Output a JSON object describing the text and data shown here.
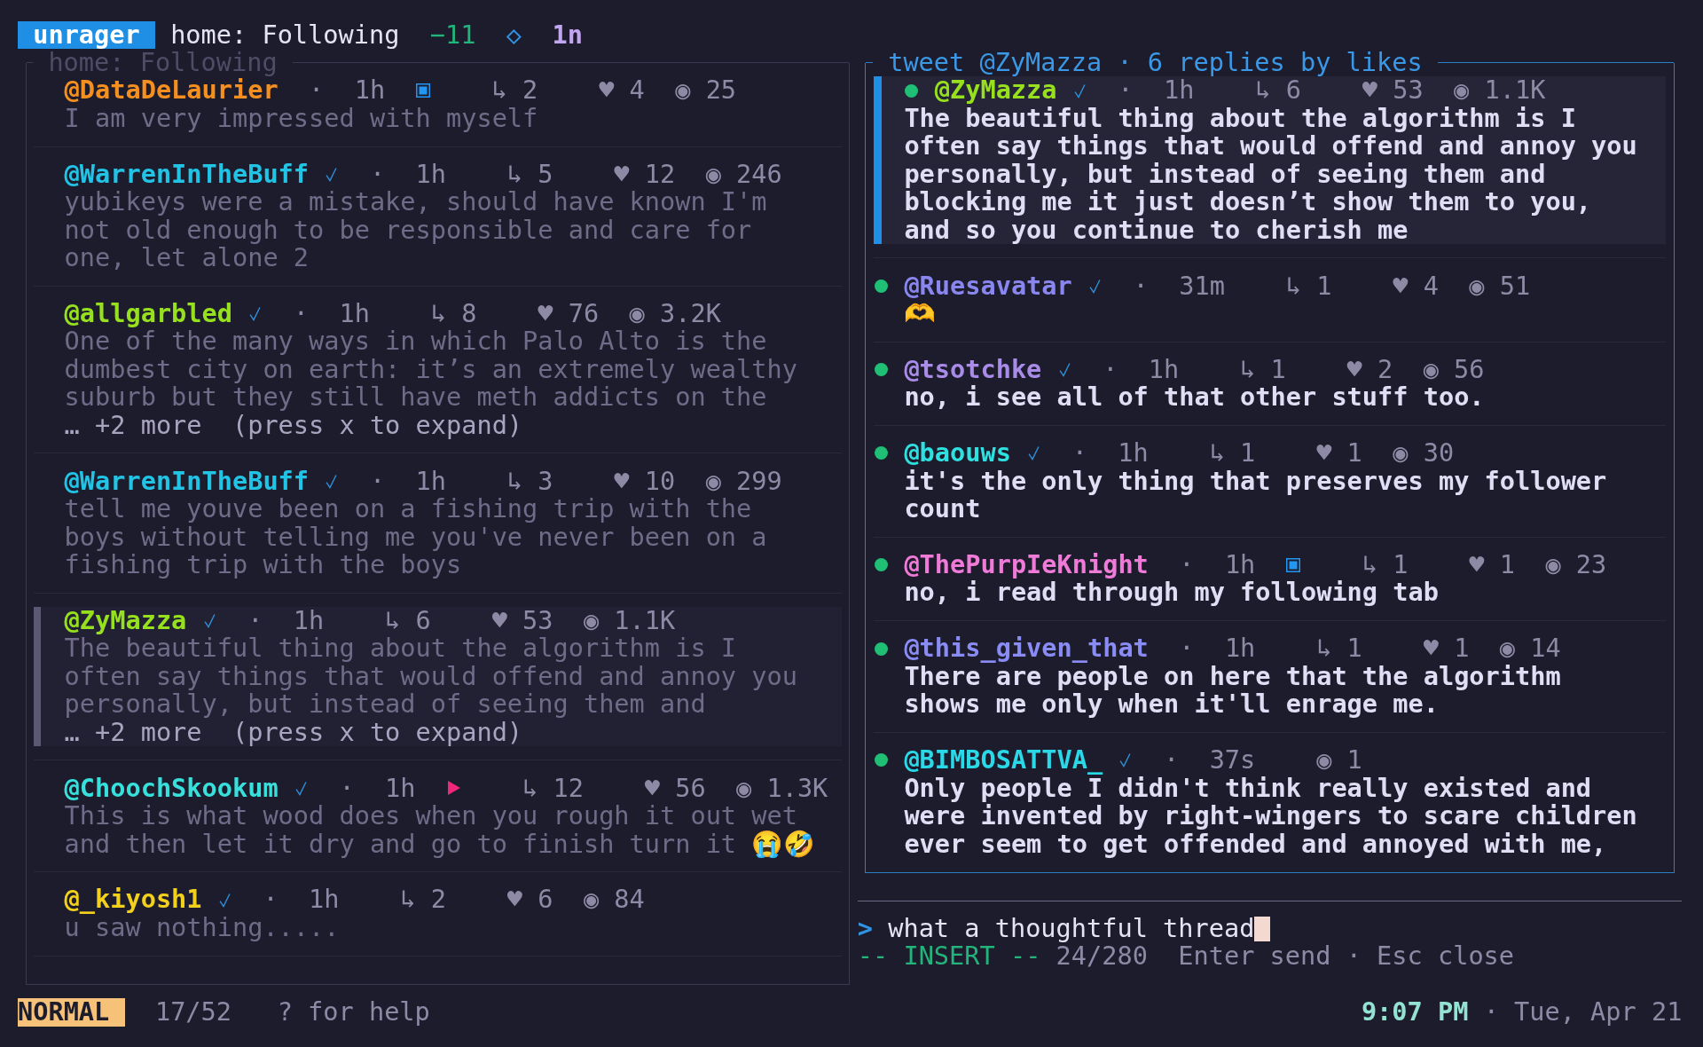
{
  "top_bar": {
    "badge": "unrager",
    "feed": "home: Following",
    "delta": "−11",
    "symbol": "◇",
    "counter": "1n"
  },
  "timeline": {
    "title": "home: Following",
    "tweets": [
      {
        "handle": "@DataDeLaurier",
        "color": "#f59020",
        "verified": false,
        "separator": "·",
        "time": "1h",
        "media": {
          "kind": "image"
        },
        "replies": "↳ 2",
        "likes": "♥ 4",
        "views": "◉ 25",
        "body": "I am very impressed with myself",
        "selected": false
      },
      {
        "handle": "@WarrenInTheBuff",
        "color": "#22c4e6",
        "verified": true,
        "separator": "·",
        "time": "1h",
        "replies": "↳ 5",
        "likes": "♥ 12",
        "views": "◉ 246",
        "body": "yubikeys were a mistake, should have known I'm\nnot old enough to be responsible and care for\none, let alone 2",
        "selected": false
      },
      {
        "handle": "@allgarbled",
        "color": "#96e01e",
        "verified": true,
        "separator": "·",
        "time": "1h",
        "replies": "↳ 8",
        "likes": "♥ 76",
        "views": "◉ 3.2K",
        "body": "One of the many ways in which Palo Alto is the\ndumbest city on earth: it’s an extremely wealthy\nsuburb but they still have meth addicts on the",
        "more": "… +2 more  (press x to expand)",
        "selected": false
      },
      {
        "handle": "@WarrenInTheBuff",
        "color": "#22c4e6",
        "verified": true,
        "separator": "·",
        "time": "1h",
        "replies": "↳ 3",
        "likes": "♥ 10",
        "views": "◉ 299",
        "body": "tell me youve been on a fishing trip with the\nboys without telling me you've never been on a\nfishing trip with the boys",
        "selected": false
      },
      {
        "handle": "@ZyMazza",
        "color": "#96e01e",
        "verified": true,
        "separator": "·",
        "time": "1h",
        "replies": "↳ 6",
        "likes": "♥ 53",
        "views": "◉ 1.1K",
        "body": "The beautiful thing about the algorithm is I\noften say things that would offend and annoy you\npersonally, but instead of seeing them and",
        "more": "… +2 more  (press x to expand)",
        "selected": true
      },
      {
        "handle": "@ChoochSkookum",
        "color": "#38e0dc",
        "verified": true,
        "separator": "·",
        "time": "1h",
        "media": {
          "kind": "video"
        },
        "replies": "↳ 12",
        "likes": "♥ 56",
        "views": "◉ 1.3K",
        "body": "This is what wood does when you rough it out wet\nand then let it dry and go to finish turn it 😭🤣",
        "selected": false
      },
      {
        "handle": "@_kiyosh1",
        "color": "#f2d01c",
        "verified": true,
        "separator": "·",
        "time": "1h",
        "replies": "↳ 2",
        "likes": "♥ 6",
        "views": "◉ 84",
        "body": "u saw nothing.....",
        "selected": false
      }
    ]
  },
  "thread": {
    "title": "tweet @ZyMazza · 6 replies by likes",
    "replies": [
      {
        "handle": "@ZyMazza",
        "color": "#96e01e",
        "verified": true,
        "dot": true,
        "separator": "·",
        "time": "1h",
        "replies": "↳ 6",
        "likes": "♥ 53",
        "views": "◉ 1.1K",
        "body": "The beautiful thing about the algorithm is I\noften say things that would offend and annoy you\npersonally, but instead of seeing them and\nblocking me it just doesn’t show them to you,\nand so you continue to cherish me",
        "selected": true
      },
      {
        "handle": "@Ruesavatar",
        "color": "#8a86f0",
        "verified": true,
        "dot": true,
        "separator": "·",
        "time": "31m",
        "replies": "↳ 1",
        "likes": "♥ 4",
        "views": "◉ 51",
        "body": "🫶",
        "selected": false
      },
      {
        "handle": "@tsotchke",
        "color": "#a98be8",
        "verified": true,
        "dot": true,
        "separator": "·",
        "time": "1h",
        "replies": "↳ 1",
        "likes": "♥ 2",
        "views": "◉ 56",
        "body": "no, i see all of that other stuff too.",
        "selected": false
      },
      {
        "handle": "@baouws",
        "color": "#2ee0e0",
        "verified": true,
        "dot": true,
        "separator": "·",
        "time": "1h",
        "replies": "↳ 1",
        "likes": "♥ 1",
        "views": "◉ 30",
        "body": "it's the only thing that preserves my follower\ncount",
        "selected": false
      },
      {
        "handle": "@ThePurpIeKnight",
        "color": "#f07ad8",
        "verified": false,
        "dot": true,
        "separator": "·",
        "time": "1h",
        "media": {
          "kind": "image"
        },
        "replies": "↳ 1",
        "likes": "♥ 1",
        "views": "◉ 23",
        "body": "no, i read through my following tab",
        "selected": false
      },
      {
        "handle": "@this_given_that",
        "color": "#8a8cf5",
        "verified": false,
        "dot": true,
        "separator": "·",
        "time": "1h",
        "replies": "↳ 1",
        "likes": "♥ 1",
        "views": "◉ 14",
        "body": "There are people on here that the algorithm\nshows me only when it'll enrage me.",
        "selected": false
      },
      {
        "handle": "@BIMBOSATTVA_",
        "color": "#2ad8e8",
        "verified": true,
        "dot": true,
        "separator": "·",
        "time": "37s",
        "views": "◉ 1",
        "body": "Only people I didn't think really existed and\nwere invented by right-wingers to scare children\never seem to get offended and annoyed with me,",
        "selected": false
      }
    ]
  },
  "composer": {
    "prompt": ">",
    "value": "what a thoughtful thread",
    "mode": "-- INSERT --",
    "counter": "24/280",
    "keys": "Enter send · Esc close"
  },
  "status_bar": {
    "mode": "NORMAL",
    "position": "17/52",
    "help": "? for help",
    "time": "9:07 PM",
    "separator": "·",
    "date": "Tue, Apr 21"
  }
}
